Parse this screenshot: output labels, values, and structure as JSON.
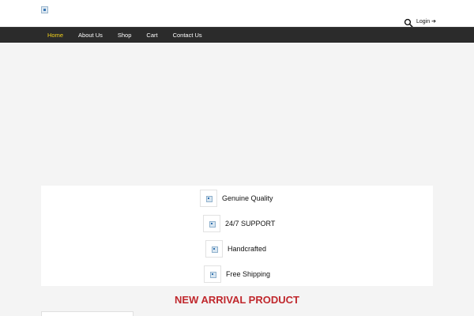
{
  "header": {
    "login_label": "Login",
    "login_arrow": "➔",
    "logo_icon": "broken-image-icon",
    "search_icon": "search-icon"
  },
  "nav": {
    "items": [
      {
        "label": "Home",
        "active": true
      },
      {
        "label": "About Us",
        "active": false
      },
      {
        "label": "Shop",
        "active": false
      },
      {
        "label": "Cart",
        "active": false
      },
      {
        "label": "Contact Us",
        "active": false
      }
    ],
    "active_color": "#f3d21b",
    "background": "#2b2b2b"
  },
  "features": [
    {
      "label": "Genuine Quality",
      "icon": "broken-image-icon"
    },
    {
      "label": "24/7 SUPPORT",
      "icon": "broken-image-icon"
    },
    {
      "label": "Handcrafted",
      "icon": "broken-image-icon"
    },
    {
      "label": "Free Shipping",
      "icon": "broken-image-icon"
    }
  ],
  "section": {
    "title": "NEW ARRIVAL PRODUCT",
    "title_color": "#c0282d"
  }
}
